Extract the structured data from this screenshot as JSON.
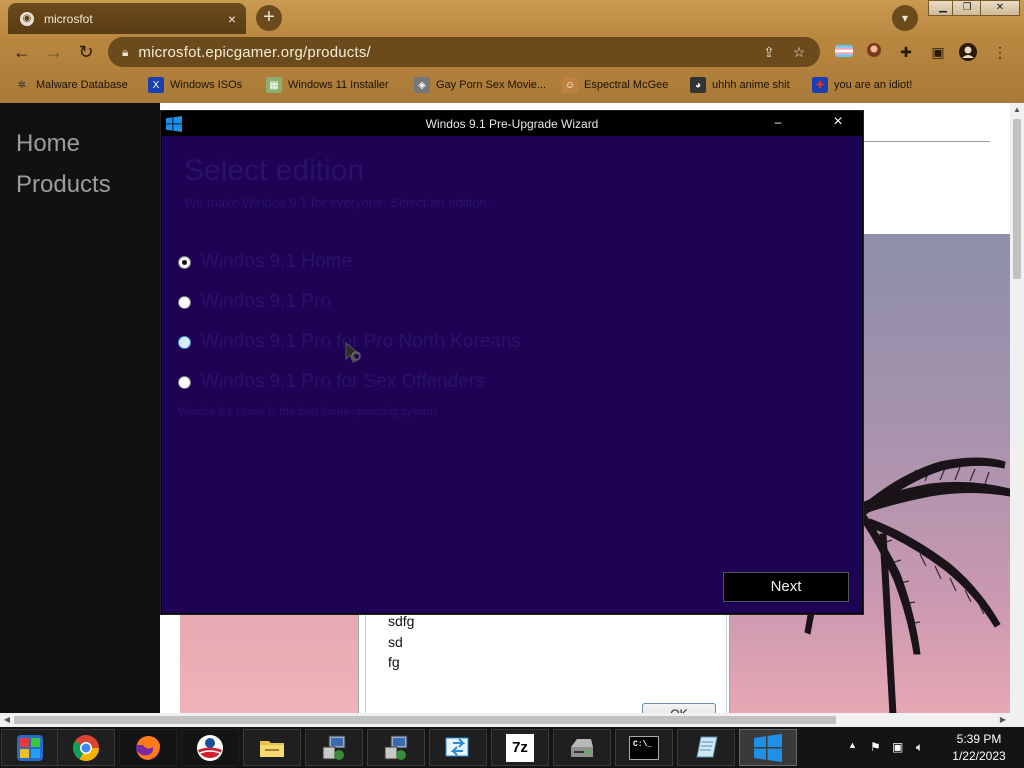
{
  "browser": {
    "tab_title": "microsfot",
    "tab_close": "×",
    "new_tab": "+",
    "url": "microsfot.epicgamer.org/products/",
    "window_controls": [
      "▁",
      "❐",
      "✕"
    ],
    "bookmarks": [
      {
        "label": "Malware Database",
        "icon": "bug-icon",
        "color": "#444444"
      },
      {
        "label": "Windows ISOs",
        "icon": "x-icon",
        "color": "#1a3fb0"
      },
      {
        "label": "Windows 11 Installer",
        "icon": "image-icon",
        "color": "#4a8a3a"
      },
      {
        "label": "Gay Porn Sex Movie...",
        "icon": "globe-icon",
        "color": "#5a5a5a"
      },
      {
        "label": "Espectral McGee",
        "icon": "face-icon",
        "color": "#b07030"
      },
      {
        "label": "uhhh anime shit",
        "icon": "anime-icon",
        "color": "#333333"
      },
      {
        "label": "you are an idiot!",
        "icon": "flag-icon",
        "color": "#b03030"
      }
    ]
  },
  "page": {
    "nav": [
      "Home",
      "Products"
    ]
  },
  "message_box": {
    "lines": [
      "sdfg",
      "sd",
      "fg"
    ],
    "ok_label": "OK"
  },
  "wizard": {
    "title": "Windos 9.1 Pre-Upgrade Wizard",
    "min_label": "–",
    "close_label": "×",
    "heading": "Select edition",
    "subheading": "We make Windos 9.1 for everyone. Select an edition.",
    "options": [
      {
        "label": "Windos 9.1 Home",
        "checked": true
      },
      {
        "label": "Windos 9.1 Pro",
        "checked": false
      },
      {
        "label": "Windos 9.1 Pro for Pro North Koreans",
        "checked": false
      },
      {
        "label": "Windos 9.1 Pro for Sex Offenders",
        "checked": false
      }
    ],
    "description": "Windos 9.1 Home is the best home operating system.",
    "next_label": "Next"
  },
  "taskbar": {
    "items": [
      {
        "name": "taskbar-tiles",
        "icon": "tiles-icon"
      },
      {
        "name": "taskbar-chrome",
        "icon": "chrome-icon"
      },
      {
        "name": "taskbar-firefox",
        "icon": "firefox-icon"
      },
      {
        "name": "taskbar-obama",
        "icon": "obama-logo-icon"
      },
      {
        "name": "taskbar-explorer",
        "icon": "folder-icon"
      },
      {
        "name": "taskbar-network",
        "icon": "network-icon"
      },
      {
        "name": "taskbar-network-2",
        "icon": "network-icon"
      },
      {
        "name": "taskbar-remote",
        "icon": "remote-icon"
      },
      {
        "name": "taskbar-7zip",
        "icon": "7zip-icon",
        "text": "7z"
      },
      {
        "name": "taskbar-drive",
        "icon": "drive-icon"
      },
      {
        "name": "taskbar-cmd",
        "icon": "terminal-icon",
        "text": "C:\\_"
      },
      {
        "name": "taskbar-notes",
        "icon": "notes-icon"
      },
      {
        "name": "taskbar-windos",
        "icon": "windows-logo-icon"
      }
    ],
    "clock_time": "5:39 PM",
    "clock_date": "1/22/2023"
  },
  "colors": {
    "wizard_bg": "#1e0355",
    "wizard_text": "#2a1266",
    "accent_blue": "#1e90e8"
  }
}
